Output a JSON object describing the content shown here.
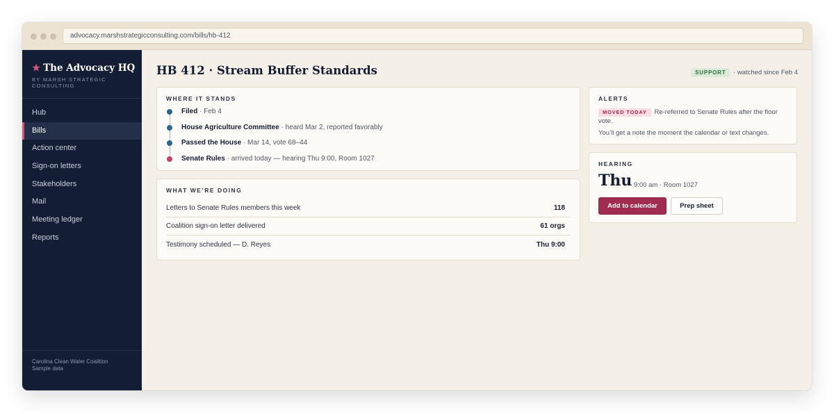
{
  "browser": {
    "url": "advocacy.marshstrategicconsulting.com/bills/hb-412"
  },
  "sidebar": {
    "brand_star": "★",
    "brand_title": "The Advocacy HQ",
    "brand_sub": "BY MARSH STRATEGIC CONSULTING",
    "items": [
      {
        "label": "Hub"
      },
      {
        "label": "Bills",
        "active": true
      },
      {
        "label": "Action center"
      },
      {
        "label": "Sign-on letters"
      },
      {
        "label": "Stakeholders"
      },
      {
        "label": "Mail"
      },
      {
        "label": "Meeting ledger"
      },
      {
        "label": "Reports"
      }
    ],
    "footer_org": "Carolina Clean Water Coalition",
    "footer_note": "Sample data"
  },
  "header": {
    "title": "HB 412 · Stream Buffer Standards",
    "status_badge": "SUPPORT",
    "status_text": "· watched since Feb 4"
  },
  "where_it_stands": {
    "heading": "WHERE IT STANDS",
    "steps": [
      {
        "title": "Filed",
        "detail": "· Feb 4",
        "current": false
      },
      {
        "title": "House Agriculture Committee",
        "detail": "· heard Mar 2, reported favorably",
        "current": false
      },
      {
        "title": "Passed the House",
        "detail": "· Mar 14, vote 68–44",
        "current": false
      },
      {
        "title": "Senate Rules",
        "detail": "· arrived today — hearing Thu 9:00, Room 1027",
        "current": true
      }
    ]
  },
  "what_were_doing": {
    "heading": "WHAT WE’RE DOING",
    "rows": [
      {
        "label": "Letters to Senate Rules members this week",
        "value": "118"
      },
      {
        "label": "Coalition sign-on letter delivered",
        "value": "61 orgs"
      },
      {
        "label": "Testimony scheduled — D. Reyes",
        "value": "Thu 9:00"
      }
    ]
  },
  "alerts": {
    "heading": "ALERTS",
    "badge": "MOVED TODAY",
    "message": "Re-referred to Senate Rules after the floor vote.",
    "note": "You’ll get a note the moment the calendar or text changes."
  },
  "hearing": {
    "heading": "HEARING",
    "day": "Thu",
    "detail": "9:00 am · Room 1027",
    "primary_button": "Add to calendar",
    "secondary_button": "Prep sheet"
  },
  "colors": {
    "sidebar_bg": "#131d33",
    "accent": "#a02c51",
    "timeline_dot": "#2f6690",
    "timeline_current": "#c3426e",
    "support_badge": "#dcebd7"
  }
}
